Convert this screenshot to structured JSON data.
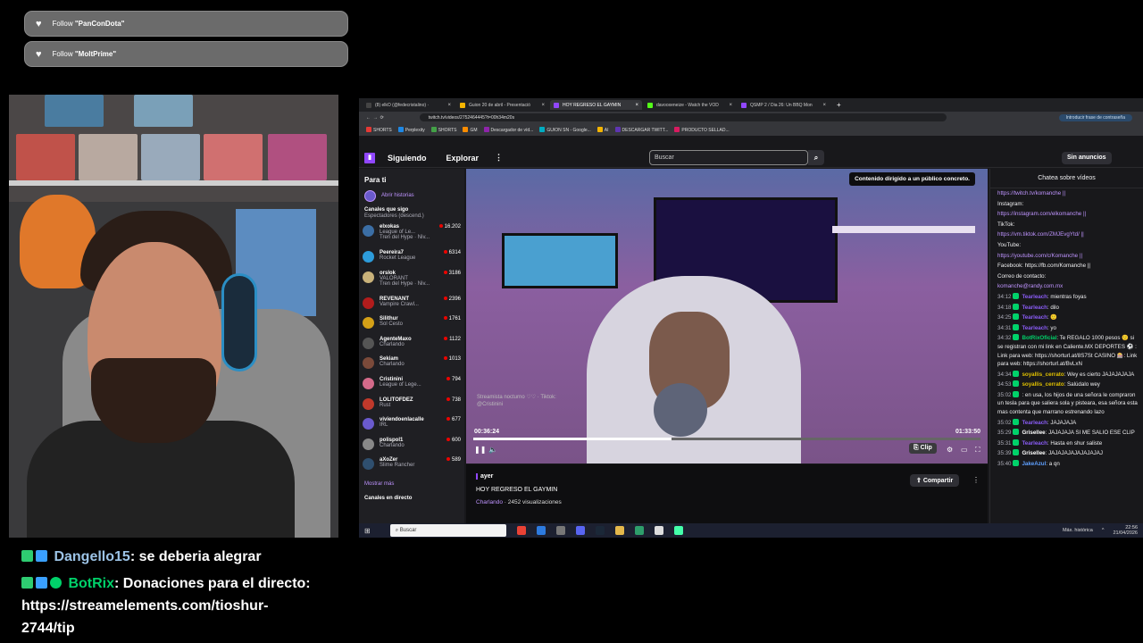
{
  "follows": [
    {
      "prefix": "Follow ",
      "name": "\"PanConDota\""
    },
    {
      "prefix": "Follow ",
      "name": "\"MoltPrime\""
    }
  ],
  "overlay_chat": [
    {
      "user": "Dangello15",
      "message": ": se deberia alegrar"
    },
    {
      "user": "BotRix",
      "message": ": Donaciones para el directo:",
      "link_line1": "https://streamelements.com/tioshur-",
      "link_line2": "2744/tip"
    }
  ],
  "browser": {
    "tabs": [
      {
        "label": "(8) elkO (@fedecristalino) ·",
        "active": false,
        "color": "#444"
      },
      {
        "label": "Guion 20 de abril - Presentació",
        "active": false,
        "color": "#f4b400"
      },
      {
        "label": "HOY REGRESO EL GAYMIN",
        "active": true,
        "color": "#9147ff"
      },
      {
        "label": "davooxeneize - Watch the VOD",
        "active": false,
        "color": "#53fc18"
      },
      {
        "label": "QSMP 2 / Dia 26: Un BBQ Mon",
        "active": false,
        "color": "#9147ff"
      }
    ],
    "new_tab": "+",
    "url": "twitch.tv/videos/2752464445?t=00h34m20s",
    "incognito_label": "Introducir frase de contraseña",
    "bookmarks": [
      "SHORTS",
      "Perplexity",
      "SHORTS",
      "GM",
      "Descargador de víd...",
      "GUION SN - Google...",
      "AI",
      "DESCARGAR TWITT...",
      "PRODUCTO SELLAD..."
    ]
  },
  "twitch": {
    "nav": {
      "following": "Siguiendo",
      "browse": "Explorar",
      "more": "⋮",
      "search_placeholder": "Buscar",
      "search_icon": "⌕",
      "ads": "Sin anuncios"
    },
    "sidebar": {
      "title": "Para ti",
      "stories": "Abrir historias",
      "following_title": "Canales que sigo",
      "sort": "Espectadores (descend.)",
      "channels": [
        {
          "name": "elxokas",
          "game": "League of Le...",
          "viewers": "16.202",
          "sub": "Tren del Hype · Niv...",
          "color": "#3b6ea5"
        },
        {
          "name": "Peereira7",
          "game": "Rocket League",
          "viewers": "6314",
          "color": "#2d9cdb"
        },
        {
          "name": "orslok",
          "game": "VALORANT",
          "viewers": "3186",
          "sub": "Tren del Hype · Niv...",
          "color": "#c9b27a"
        },
        {
          "name": "REVENANT",
          "game": "Vampire Crawl...",
          "viewers": "2396",
          "color": "#b21c1c"
        },
        {
          "name": "Silithur",
          "game": "Sol Cesto",
          "viewers": "1761",
          "color": "#d4a017"
        },
        {
          "name": "AgenteMaxo",
          "game": "Charlando",
          "viewers": "1122",
          "color": "#555"
        },
        {
          "name": "Sekiam",
          "game": "Charlando",
          "viewers": "1013",
          "color": "#7b4a3a"
        },
        {
          "name": "Cristinini",
          "game": "League of Lege...",
          "viewers": "794",
          "color": "#d46a8a"
        },
        {
          "name": "LOLITOFDEZ",
          "game": "Rust",
          "viewers": "738",
          "color": "#c0392b"
        },
        {
          "name": "viviendoenlacalle",
          "game": "IRL",
          "viewers": "677",
          "color": "#6a5acd"
        },
        {
          "name": "polispol1",
          "game": "Charlando",
          "viewers": "600",
          "color": "#888"
        },
        {
          "name": "aXoZer",
          "game": "Slime Rancher",
          "viewers": "589",
          "color": "#2f4f6f"
        }
      ],
      "show_more": "Mostrar más",
      "live_title": "Canales en directo"
    },
    "player": {
      "content_badge": "Contenido dirigido a un público concreto.",
      "watermark": "Streamista nocturno ♡♡ · Tiktok: @Cristinini",
      "current_time": "00:36:24",
      "duration": "01:33:50",
      "progress": 0.39,
      "clip": "Clip"
    },
    "video_info": {
      "when": "ayer",
      "title": "HOY REGRESO EL GAYMIN",
      "category": "Charlando",
      "views": " · 2452 visualizaciones",
      "share": "Compartir"
    },
    "chat": {
      "title": "Chatea sobre vídeos",
      "lines": [
        {
          "ts": "",
          "user": "",
          "ucolor": "#efeff1",
          "text": "https://twitch.tv/komanche ||",
          "link": true
        },
        {
          "ts": "",
          "user": "",
          "ucolor": "#efeff1",
          "text": "Instagram:"
        },
        {
          "ts": "",
          "user": "",
          "ucolor": "#efeff1",
          "text": "https://instagram.com/elkomanche ||",
          "link": true
        },
        {
          "ts": "",
          "user": "",
          "ucolor": "#efeff1",
          "text": "TikTok:"
        },
        {
          "ts": "",
          "user": "",
          "ucolor": "#efeff1",
          "text": "https://vm.tiktok.com/ZMJEvgYtd/ ||",
          "link": true
        },
        {
          "ts": "",
          "user": "",
          "ucolor": "#efeff1",
          "text": "YouTube:"
        },
        {
          "ts": "",
          "user": "",
          "ucolor": "#efeff1",
          "text": "https://youtube.com/c/Komanche ||",
          "link": true
        },
        {
          "ts": "",
          "user": "",
          "ucolor": "#efeff1",
          "text": "Facebook: https://fb.com/Komanche ||"
        },
        {
          "ts": "",
          "user": "",
          "ucolor": "#efeff1",
          "text": "Correo de contacto:"
        },
        {
          "ts": "",
          "user": "",
          "ucolor": "#efeff1",
          "text": "komanche@randy.com.mx",
          "link": true
        },
        {
          "ts": "34:12",
          "user": "Tearleach",
          "ucolor": "#8a5cf6",
          "text": ": mientras foyas"
        },
        {
          "ts": "34:18",
          "user": "Tearleach",
          "ucolor": "#8a5cf6",
          "text": ": dilo"
        },
        {
          "ts": "34:25",
          "user": "Tearleach",
          "ucolor": "#8a5cf6",
          "text": ": 🙂"
        },
        {
          "ts": "34:31",
          "user": "Tearleach",
          "ucolor": "#8a5cf6",
          "text": ": yo"
        },
        {
          "ts": "34:32",
          "user": "BotRixOficial",
          "ucolor": "#00d26a",
          "text": ": Te REGALO 1000 pesos 🙂 si se registran con mi link en Caliente.MX DEPORTES ⚽ : Link para web: https://shorturl.at/8S7St CASINO 🎰: Link para web: https://shorturl.at/BvLxN"
        },
        {
          "ts": "34:34",
          "user": "soyallis_cerrato",
          "ucolor": "#e0c000",
          "text": ": Wey es cierto JAJAJAJAJA"
        },
        {
          "ts": "34:53",
          "user": "soyallis_cerrato",
          "ucolor": "#e0c000",
          "text": ": Salúdalo wey"
        },
        {
          "ts": "35:02",
          "user": "",
          "ucolor": "#5f5fff",
          "text": ": en usa, los hijos de una señora le compraron un tesla para que saliera sola y pisteara, esa señora esta mas contenta que marrano estrenando lazo"
        },
        {
          "ts": "35:02",
          "user": "Tearleach",
          "ucolor": "#8a5cf6",
          "text": ": JAJAJAJA"
        },
        {
          "ts": "35:29",
          "user": "Grisellee",
          "ucolor": "#ffffff",
          "text": ": JAJAJAJA SI ME SALIO ESE CLIP"
        },
        {
          "ts": "35:31",
          "user": "Tearleach",
          "ucolor": "#8a5cf6",
          "text": ": Hasta en shur saliste"
        },
        {
          "ts": "35:39",
          "user": "Grisellee",
          "ucolor": "#ffffff",
          "text": ": JAJAJAJAJAJAJAJAJ"
        },
        {
          "ts": "35:40",
          "user": "JakeAzul",
          "ucolor": "#5fa0ff",
          "text": ": a qn"
        }
      ]
    }
  },
  "taskbar": {
    "search": "Buscar",
    "weather": "Máx. histórica",
    "time": "22:56",
    "date": "21/04/2026"
  },
  "colors": {
    "twitch_purple": "#9147ff",
    "bg": "#18181b"
  }
}
